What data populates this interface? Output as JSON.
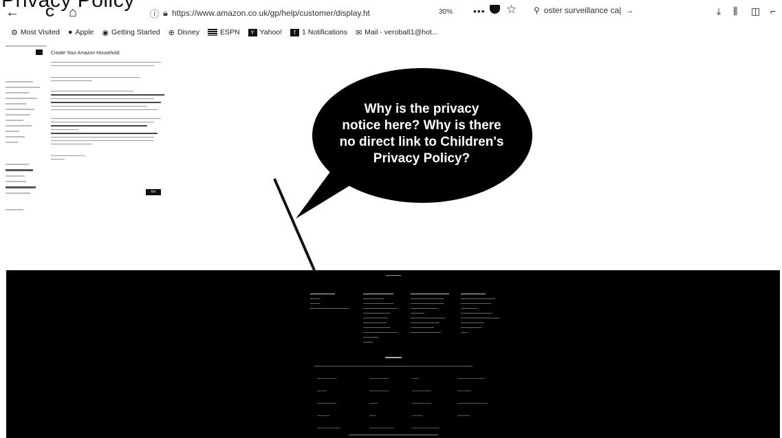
{
  "slide_title": "Privacy Policy",
  "browser": {
    "back_icon": "←",
    "reload_icon": "C",
    "home_icon": "⌂",
    "url": "https://www.amazon.co.uk/gp/help/customer/display.ht",
    "zoom": "30%",
    "menu_dots": "•••",
    "search_text": "oster surveillance ca|",
    "bookmarks": [
      {
        "label": "Most Visited"
      },
      {
        "label": "Apple"
      },
      {
        "label": "Getting Started"
      },
      {
        "label": "Disney"
      },
      {
        "label": "ESPN"
      },
      {
        "label": "Yahoo!"
      },
      {
        "label": "1 Notifications"
      },
      {
        "label": "Mail - veroba81@hot..."
      }
    ]
  },
  "page": {
    "section_title": "Create Your Amazon Household",
    "go_button": "Go"
  },
  "callout": {
    "line1": "Why is the privacy",
    "line2": "notice here? Why is there",
    "line3": "no direct link to Children's",
    "line4": "Privacy Policy?"
  }
}
